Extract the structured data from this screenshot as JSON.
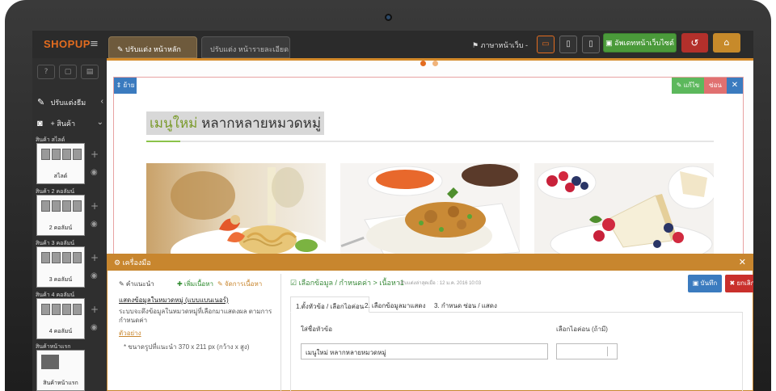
{
  "topbar": {
    "logo": "SHOPUP",
    "menu_icon": "hamburger-icon",
    "tab_active": "✎ ปรับแต่ง หน้าหลัก",
    "tab_inactive": "ปรับแต่ง หน้ารายละเอียด",
    "language": "⚑ ภาษาหน้าเว็บ -",
    "publish_button": "▣ อัพเดทหน้าเว็บไซต์",
    "undo_icon": "undo-icon",
    "home_icon": "home-icon",
    "colors": {
      "brand": "#e36c1f",
      "publish": "#4a9a3a",
      "undo": "#b3302b",
      "home": "#c78a2a"
    }
  },
  "sidebar": {
    "tools": [
      "?",
      "▢",
      "▤"
    ],
    "menu": [
      {
        "label": "ปรับแต่งธีม",
        "icon": "edit-icon"
      },
      {
        "label": "+ สินค้า",
        "icon": "gift-icon"
      }
    ],
    "blocks": [
      {
        "header": "สินค้า สไลด์",
        "name": "สไลด์"
      },
      {
        "header": "สินค้า 2 คอลัมน์",
        "name": "2 คอลัมน์"
      },
      {
        "header": "สินค้า 3 คอลัมน์",
        "name": "3 คอลัมน์"
      },
      {
        "header": "สินค้า 4 คอลัมน์",
        "name": "4 คอลัมน์"
      },
      {
        "header": "สินค้าหน้าแรก",
        "name": "สินค้าหน้าแรก"
      }
    ]
  },
  "section": {
    "position_label": "⇕ ย้าย",
    "edit_label": "✎ แก้ไข",
    "hide_label": "ซ่อน",
    "close_label": "✕",
    "title_accent": "เมนูใหม่",
    "title_rest": "หลากหลายหมวดหมู่"
  },
  "tools": {
    "header": "⚙ เครื่องมือ",
    "close": "✕",
    "help_label": "✎ คำแนะนำ",
    "add_content": "✚ เพิ่มเนื้อหา",
    "manage_content": "✎ จัดการเนื้อหา",
    "link_title": "แสดงข้อมูลในหมวดหมู่ (แบบแบนเนอร์)",
    "description": "ระบบจะดึงข้อมูลในหมวดหมู่ที่เลือกมาแสดงผล ตามการกำหนดค่า",
    "example_link": "ตัวอย่าง",
    "note": "* ขนาดรูปที่แนะนำ 370 x 211 px (กว้าง x สูง)",
    "breadcrumb": "☑ เลือกข้อมูล / กำหนดค่า > เนื้อหา1",
    "breadcrumb_meta": "ปรับแต่งล่าสุดเมื่อ : 12 ม.ค. 2016 10:03",
    "save_button": "▣ บันทึก",
    "cancel_button": "✖ ยกเลิก",
    "tabs": [
      "1.ตั้งหัวข้อ / เลือกไอค่อน",
      "2. เลือกข้อมูลมาแสดง",
      "3. กำหนด ซ่อน / แสดง"
    ],
    "field_title_label": "ใส่ชื่อหัวข้อ",
    "field_title_value": "เมนูใหม่ หลากหลายหมวดหมู่",
    "field_icon_label": "เลือกไอค่อน (ถ้ามี)"
  }
}
